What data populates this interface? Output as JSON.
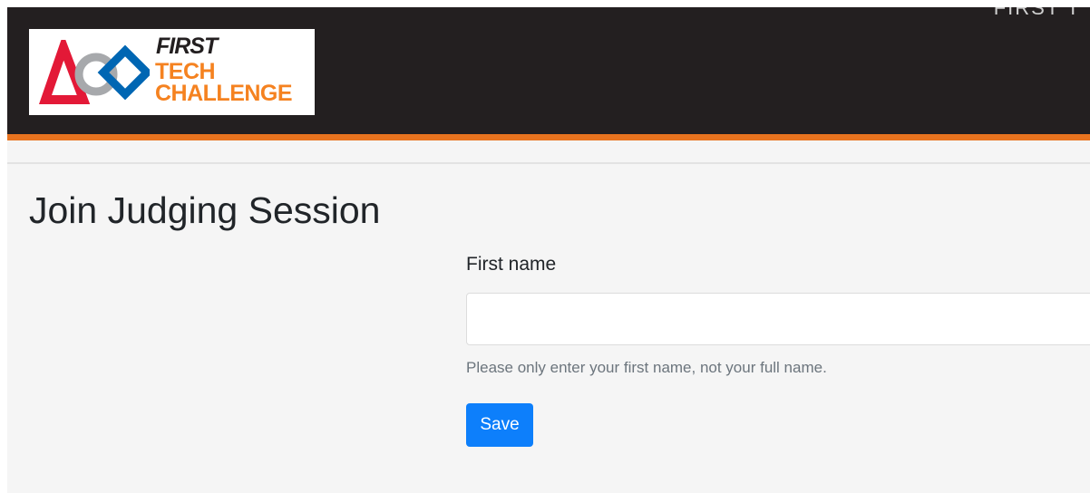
{
  "header": {
    "top_right_partial_text": "FIRST T",
    "logo": {
      "first": "FIRST",
      "tech": "TECH",
      "challenge": "CHALLENGE"
    }
  },
  "page": {
    "title": "Join Judging Session"
  },
  "form": {
    "first_name_label": "First name",
    "first_name_value": "",
    "first_name_placeholder": "",
    "help_text": "Please only enter your first name, not your full name.",
    "save_label": "Save"
  },
  "colors": {
    "header_background": "#231f20",
    "header_stripe": "#e8731f",
    "logo_orange": "#f58220",
    "logo_red": "#e31937",
    "logo_blue": "#0066b3",
    "button_primary": "#0d7ffb"
  }
}
